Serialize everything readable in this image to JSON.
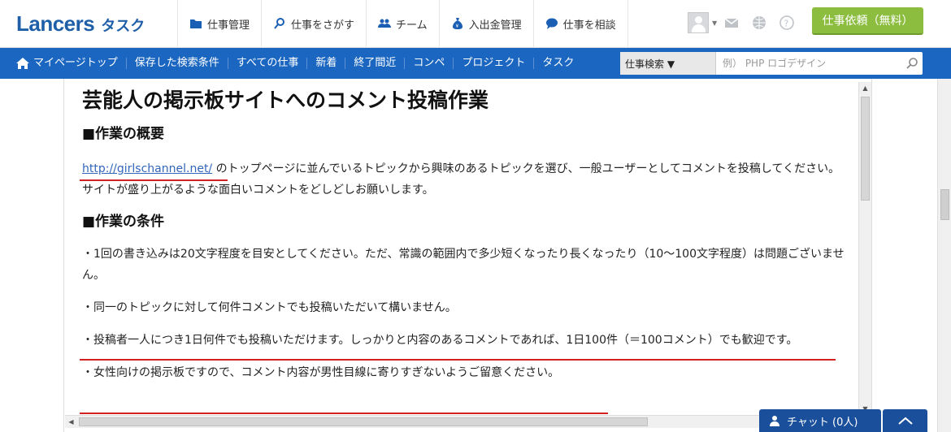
{
  "header": {
    "logo_main": "Lancers",
    "logo_sub": "タスク",
    "nav": [
      {
        "label": "仕事管理",
        "icon": "folder-icon"
      },
      {
        "label": "仕事をさがす",
        "icon": "search-icon"
      },
      {
        "label": "チーム",
        "icon": "team-icon"
      },
      {
        "label": "入出金管理",
        "icon": "money-bag-icon"
      },
      {
        "label": "仕事を相談",
        "icon": "chat-bubble-icon"
      }
    ],
    "order_button": "仕事依頼（無料）"
  },
  "subnav": {
    "items": [
      "マイページトップ",
      "保存した検索条件",
      "すべての仕事",
      "新着",
      "終了間近",
      "コンペ",
      "プロジェクト",
      "タスク"
    ],
    "search_select": "仕事検索 ▼",
    "search_placeholder": "例） PHP ロゴデザイン"
  },
  "article": {
    "title": "芸能人の掲示板サイトへのコメント投稿作業",
    "section1": "■作業の概要",
    "link": "http://girlschannel.net/",
    "p1_rest": " のトップページに並んでいるトピックから興味のあるトピックを選び、一般ユーザーとしてコメントを投稿してください。サイトが盛り上がるような面白いコメントをどしどしお願いします。",
    "section2": "■作業の条件",
    "cond1": "・1回の書き込みは20文字程度を目安としてください。ただ、常識の範囲内で多少短くなったり長くなったり（10〜100文字程度）は問題ございません。",
    "cond2": "・同一のトピックに対して何件コメントでも投稿いただいて構いません。",
    "cond3": "・投稿者一人につき1日何件でも投稿いただけます。しっかりと内容のあるコメントであれば、1日100件（＝100コメント）でも歓迎です。",
    "cond4": "・女性向けの掲示板ですので、コメント内容が男性目線に寄りすぎないようご留意ください。"
  },
  "chat": {
    "label": "チャット (0人)"
  },
  "colors": {
    "brand_blue": "#1a66c0",
    "order_green": "#8cbd3f",
    "annotation_red": "#d32020"
  }
}
